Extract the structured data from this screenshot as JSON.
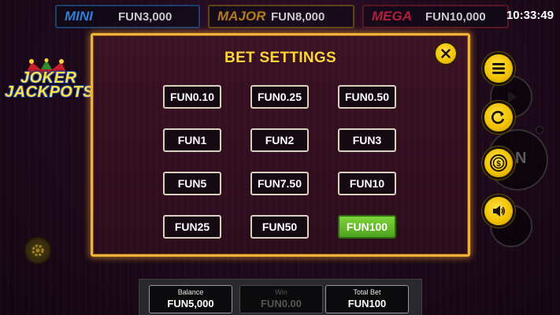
{
  "jackpots": [
    {
      "name": "MINI",
      "value": "FUN3,000",
      "color": "#2f7fd8"
    },
    {
      "name": "MAJOR",
      "value": "FUN8,000",
      "color": "#b27c1c"
    },
    {
      "name": "MEGA",
      "value": "FUN10,000",
      "color": "#b51d3a"
    }
  ],
  "clock": "10:33:49",
  "logo": {
    "line1": "JOKER",
    "line2": "JACKPOTS"
  },
  "modal": {
    "title": "BET SETTINGS",
    "close_icon": "close-icon",
    "bets": [
      [
        "FUN0.10",
        "FUN0.25",
        "FUN0.50"
      ],
      [
        "FUN1",
        "FUN2",
        "FUN3"
      ],
      [
        "FUN5",
        "FUN7.50",
        "FUN10"
      ],
      [
        "FUN25",
        "FUN50",
        "FUN100"
      ]
    ],
    "selected_bet": "FUN100"
  },
  "controls": {
    "menu_icon": "menu-icon",
    "autoplay_icon": "refresh-icon",
    "bet_icon": "coin-icon",
    "sound_icon": "speaker-icon",
    "spin_partial": "N"
  },
  "footer": {
    "balance_label": "Balance",
    "balance_value": "FUN5,000",
    "win_label": "Win",
    "win_value": "FUN0.00",
    "total_bet_label": "Total Bet",
    "total_bet_value": "FUN100"
  },
  "colors": {
    "accent_yellow": "#ffd43a",
    "modal_border": "#f0b23a",
    "selected_green": "#5cb82a"
  }
}
